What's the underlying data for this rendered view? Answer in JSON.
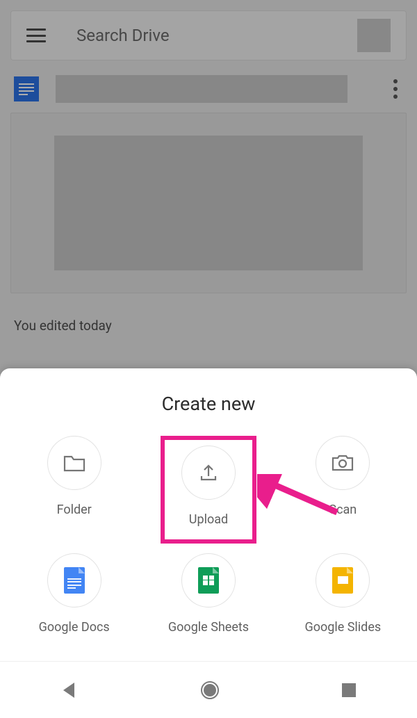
{
  "topbar": {
    "search_placeholder": "Search Drive"
  },
  "file": {
    "edited_label": "You edited today"
  },
  "sheet": {
    "title": "Create new",
    "options": [
      {
        "label": "Folder",
        "icon": "folder-icon"
      },
      {
        "label": "Upload",
        "icon": "upload-icon"
      },
      {
        "label": "Scan",
        "icon": "camera-icon"
      },
      {
        "label": "Google Docs",
        "icon": "docs-icon"
      },
      {
        "label": "Google Sheets",
        "icon": "sheets-icon"
      },
      {
        "label": "Google Slides",
        "icon": "slides-icon"
      }
    ]
  },
  "annotation": {
    "highlighted_option_index": 1,
    "arrow_color": "#e91e8c"
  }
}
